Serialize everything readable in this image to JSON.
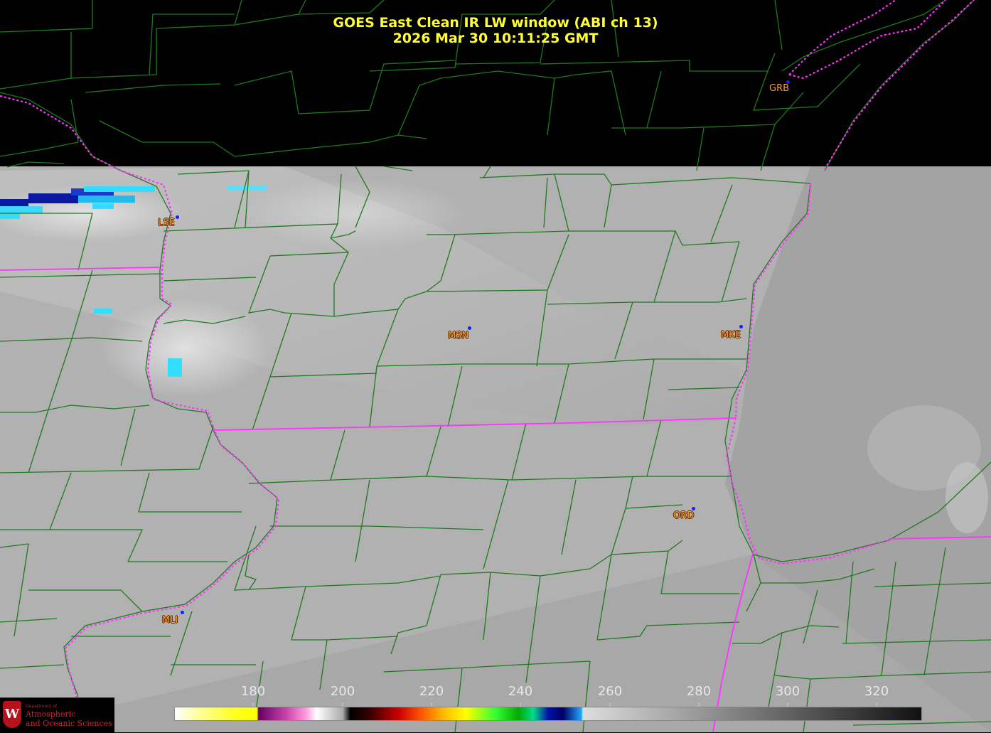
{
  "title": {
    "line1": "GOES East Clean IR LW window (ABI ch 13)",
    "line2": "2026 Mar 30  10:11:25 GMT"
  },
  "stations": [
    {
      "code": "GRB"
    },
    {
      "code": "LSE"
    },
    {
      "code": "MSN"
    },
    {
      "code": "MKE"
    },
    {
      "code": "ORD"
    },
    {
      "code": "MLI"
    }
  ],
  "colorbar": {
    "ticks": [
      "180",
      "200",
      "220",
      "240",
      "260",
      "280",
      "300",
      "320"
    ]
  },
  "logo": {
    "small": "Department of",
    "line1": "Atmospheric",
    "line2": "and Oceanic Sciences",
    "shield": "W"
  },
  "colors": {
    "title": "#ffff33",
    "county_lines": "#1f7a1f",
    "state_borders": "#ff33ff",
    "station_label": "#ff9c33",
    "station_dot": "#1020ff",
    "logo_red": "#c0202a"
  }
}
